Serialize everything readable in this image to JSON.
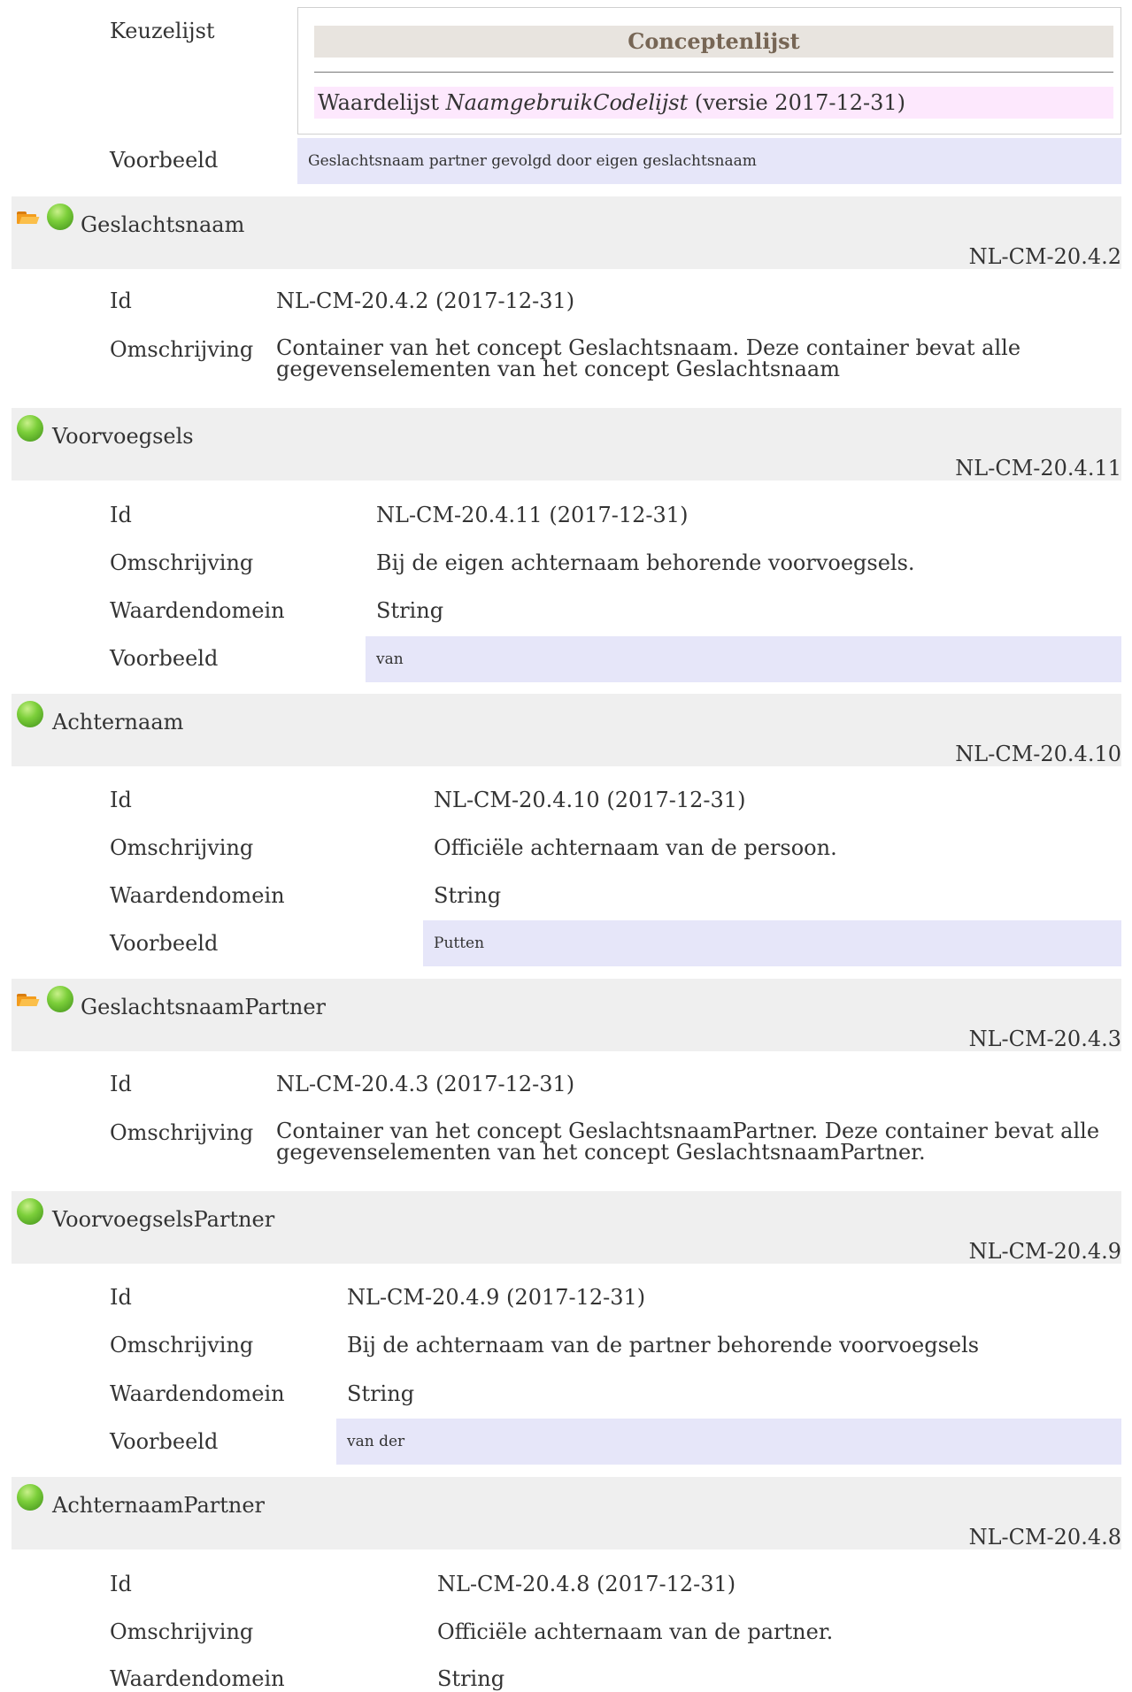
{
  "top": {
    "keuzelijst_label": "Keuzelijst",
    "conceptenlijst_title": "Conceptenlijst",
    "waardelijst_prefix": "Waardelijst",
    "waardelijst_name": "NaamgebruikCodelijst",
    "waardelijst_suffix": "(versie 2017-12-31)",
    "voorbeeld_label": "Voorbeeld",
    "voorbeeld_value": "Geslachtsnaam partner gevolgd door eigen geslachtsnaam"
  },
  "sections": [
    {
      "title": "Geslachtsnaam",
      "code": "NL-CM-20.4.2",
      "icons": [
        "folder-open-icon",
        "green-ball-icon"
      ],
      "id_label": "Id",
      "id_value": "NL-CM-20.4.2 (2017-12-31)",
      "omschrijving_label": "Omschrijving",
      "omschrijving_value": "Container van het concept Geslachtsnaam. Deze container bevat alle gegevenselementen van het concept Geslachtsnaam"
    },
    {
      "title": "Voorvoegsels",
      "code": "NL-CM-20.4.11",
      "icons": [
        "green-ball-icon"
      ],
      "id_label": "Id",
      "id_value": "NL-CM-20.4.11 (2017-12-31)",
      "omschrijving_label": "Omschrijving",
      "omschrijving_value": "Bij de eigen achternaam behorende voorvoegsels.",
      "waardendomein_label": "Waardendomein",
      "waardendomein_value": "String",
      "voorbeeld_label": "Voorbeeld",
      "voorbeeld_value": "van"
    },
    {
      "title": "Achternaam",
      "code": "NL-CM-20.4.10",
      "icons": [
        "green-ball-icon"
      ],
      "id_label": "Id",
      "id_value": "NL-CM-20.4.10 (2017-12-31)",
      "omschrijving_label": "Omschrijving",
      "omschrijving_value": "Officiële achternaam van de persoon.",
      "waardendomein_label": "Waardendomein",
      "waardendomein_value": "String",
      "voorbeeld_label": "Voorbeeld",
      "voorbeeld_value": "Putten"
    },
    {
      "title": "GeslachtsnaamPartner",
      "code": "NL-CM-20.4.3",
      "icons": [
        "folder-open-icon",
        "green-ball-icon"
      ],
      "id_label": "Id",
      "id_value": "NL-CM-20.4.3 (2017-12-31)",
      "omschrijving_label": "Omschrijving",
      "omschrijving_value": "Container van het concept GeslachtsnaamPartner. Deze container bevat alle gegevenselementen van het concept GeslachtsnaamPartner."
    },
    {
      "title": "VoorvoegselsPartner",
      "code": "NL-CM-20.4.9",
      "icons": [
        "green-ball-icon"
      ],
      "id_label": "Id",
      "id_value": "NL-CM-20.4.9 (2017-12-31)",
      "omschrijving_label": "Omschrijving",
      "omschrijving_value": "Bij de achternaam van de partner behorende voorvoegsels",
      "waardendomein_label": "Waardendomein",
      "waardendomein_value": "String",
      "voorbeeld_label": "Voorbeeld",
      "voorbeeld_value": "van der"
    },
    {
      "title": "AchternaamPartner",
      "code": "NL-CM-20.4.8",
      "icons": [
        "green-ball-icon"
      ],
      "id_label": "Id",
      "id_value": "NL-CM-20.4.8 (2017-12-31)",
      "omschrijving_label": "Omschrijving",
      "omschrijving_value": "Officiële achternaam van de partner.",
      "waardendomein_label": "Waardendomein",
      "waardendomein_value": "String"
    }
  ],
  "colors": {
    "header_bg": "#efefef",
    "example_bg": "#e6e6f9",
    "waardelijst_bg": "#fde8fd",
    "concept_head_bg": "#e8e4df",
    "ball": "#7ccf3a",
    "folder": "#f39c1d"
  }
}
